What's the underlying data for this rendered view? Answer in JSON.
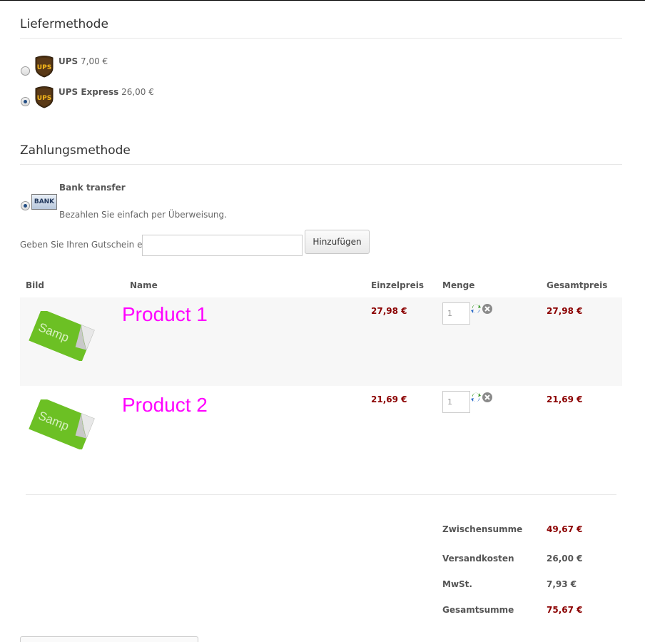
{
  "shipping": {
    "title": "Liefermethode",
    "options": [
      {
        "name": "UPS",
        "price": "7,00 €",
        "selected": false
      },
      {
        "name": "UPS Express",
        "price": "26,00 €",
        "selected": true
      }
    ]
  },
  "payment": {
    "title": "Zahlungsmethode",
    "method": {
      "logo_text": "BANK",
      "name": "Bank transfer",
      "description": "Bezahlen Sie einfach per Überweisung.",
      "selected": true
    }
  },
  "voucher": {
    "label": "Geben Sie Ihren Gutschein ein",
    "value": "",
    "button_label": "Hinzufügen"
  },
  "cart": {
    "headers": {
      "image": "Bild",
      "name": "Name",
      "unit_price": "Einzelpreis",
      "quantity": "Menge",
      "total": "Gesamtpreis"
    },
    "items": [
      {
        "thumb_text": "Samp",
        "name": "Product 1",
        "unit_price": "27,98 €",
        "quantity": "1",
        "total": "27,98 €"
      },
      {
        "thumb_text": "Samp",
        "name": "Product 2",
        "unit_price": "21,69 €",
        "quantity": "1",
        "total": "21,69 €"
      }
    ]
  },
  "totals": {
    "subtotal_label": "Zwischensumme",
    "subtotal": "49,67 €",
    "shipping_label": "Versandkosten",
    "shipping": "26,00 €",
    "tax_label": "MwSt.",
    "tax": "7,93 €",
    "grand_total_label": "Gesamtsumme",
    "grand_total": "75,67 €"
  },
  "colors": {
    "price_red": "#8b0000",
    "product_name": "#ff00ff",
    "thumb_green": "#6cc024"
  }
}
